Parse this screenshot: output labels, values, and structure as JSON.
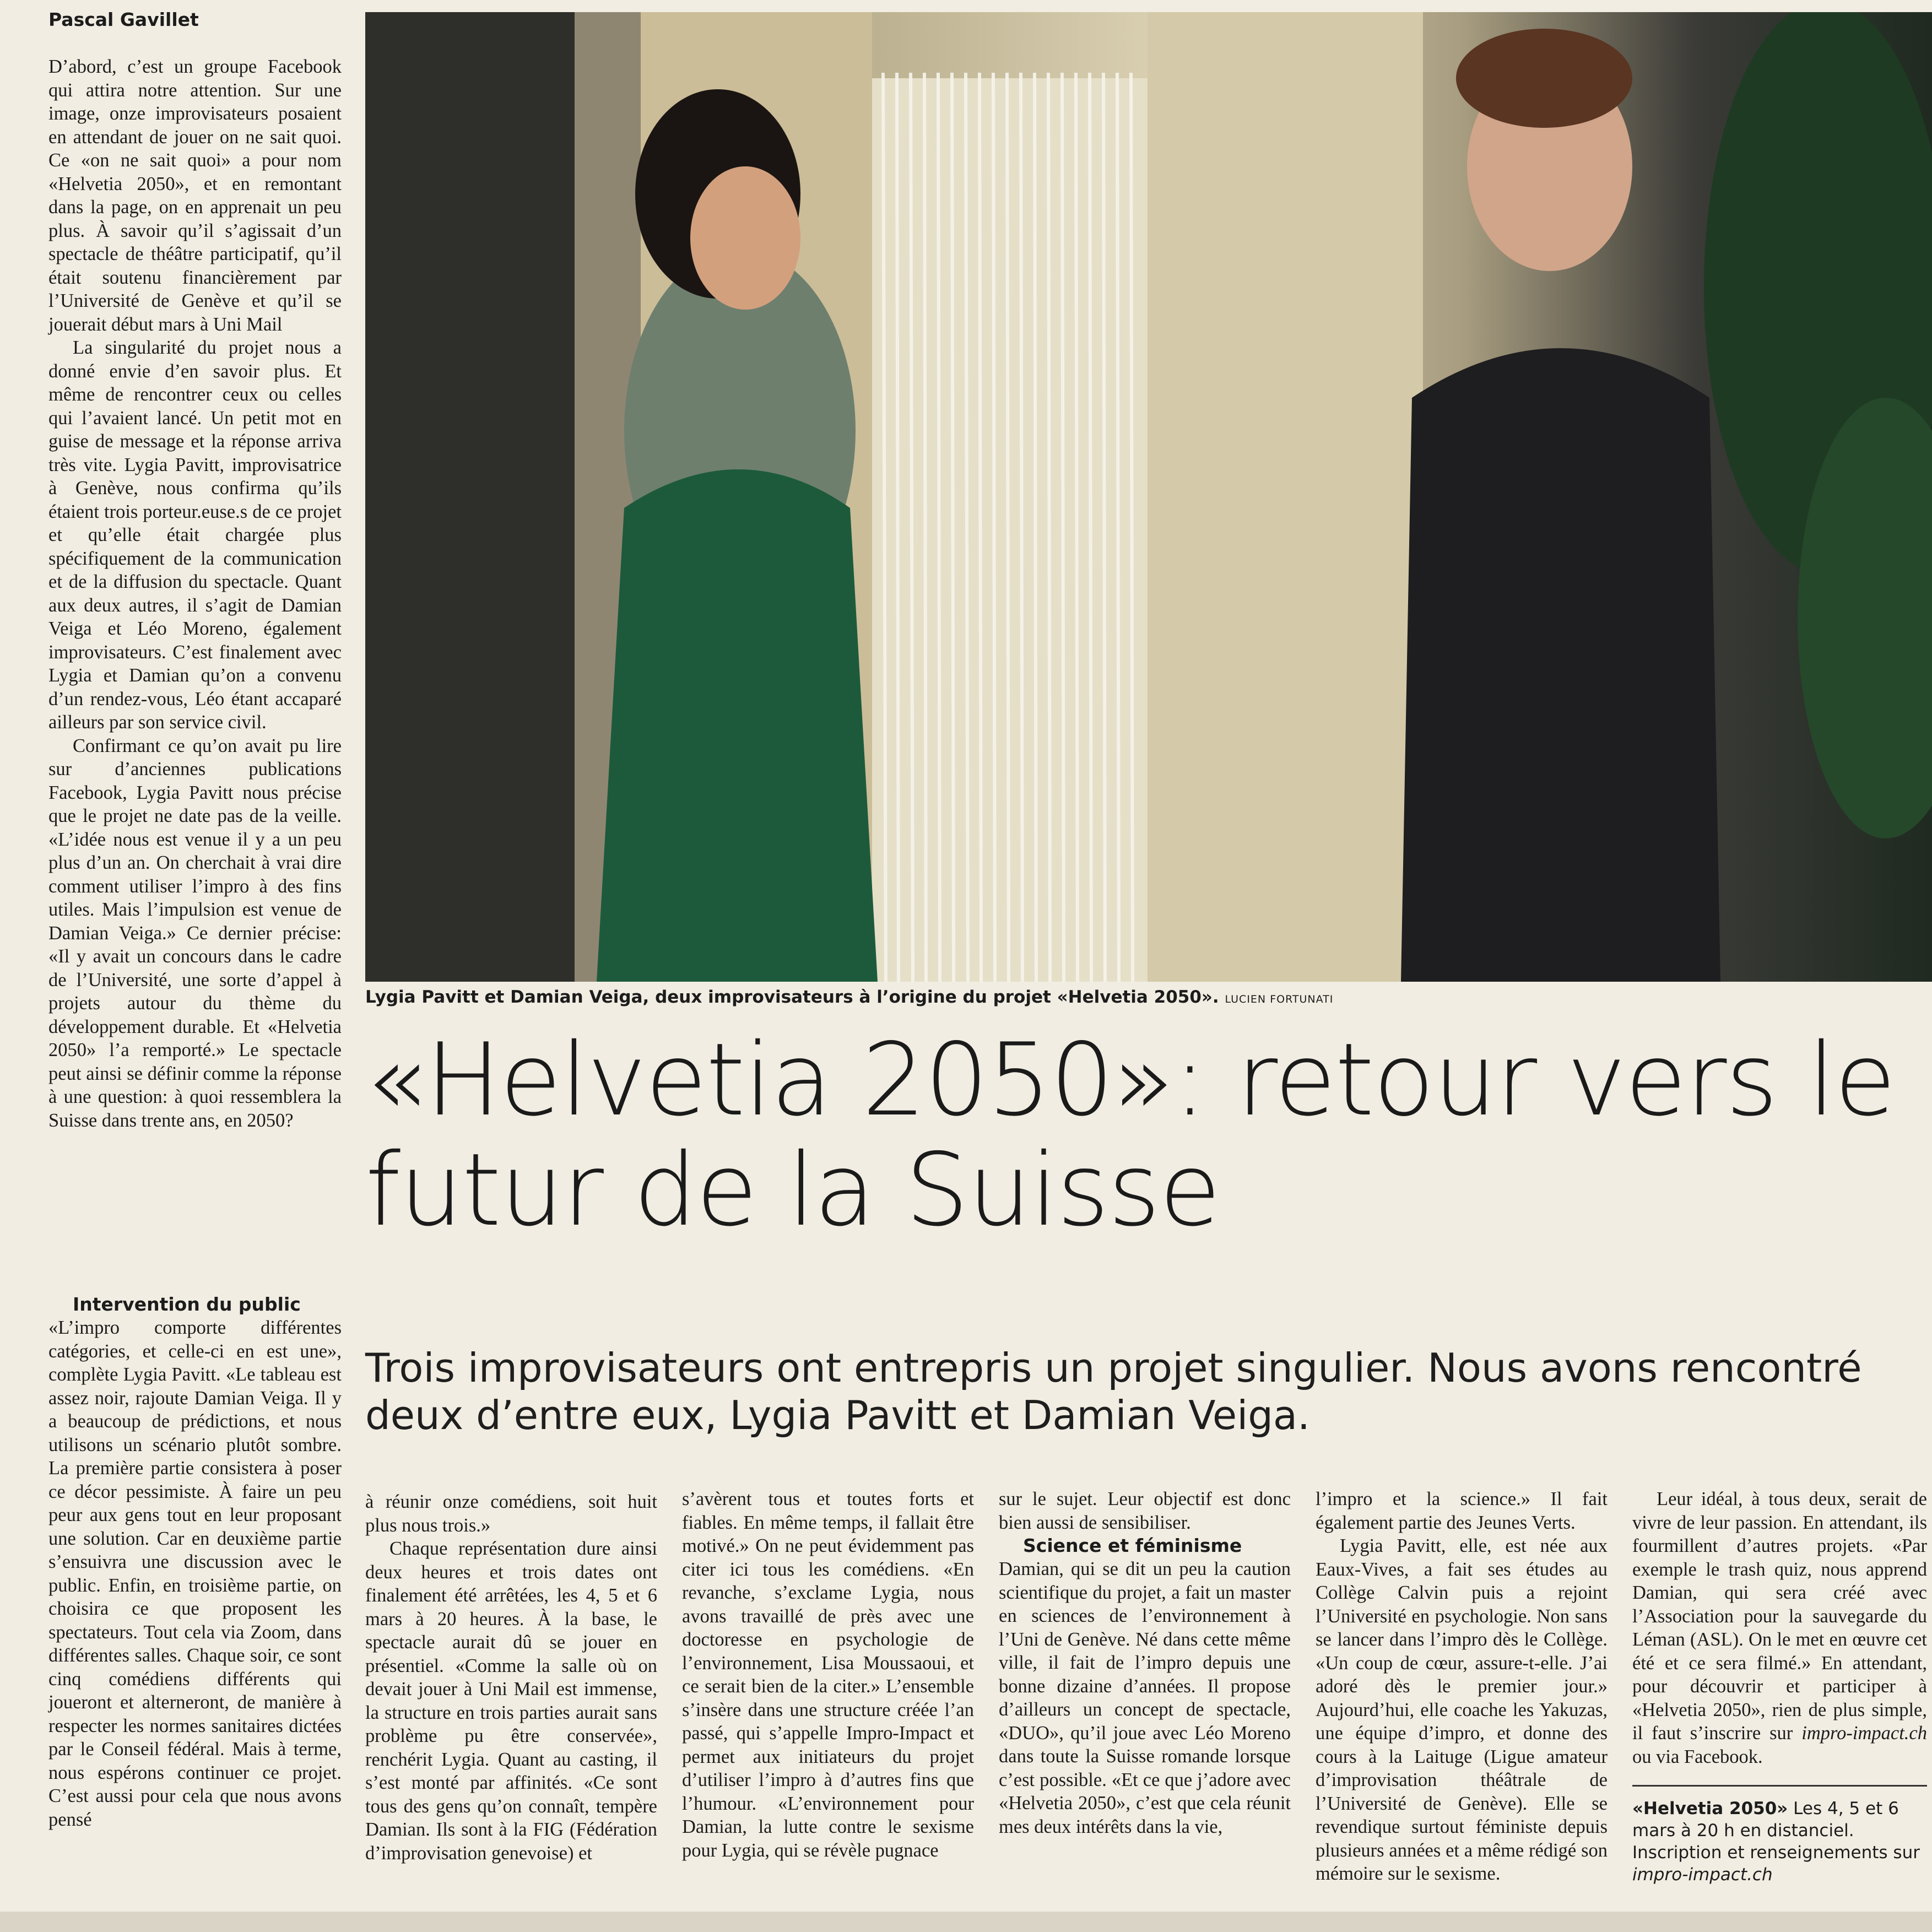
{
  "byline": "Pascal Gavillet",
  "col1_paragraphs": [
    "D’abord, c’est un groupe Facebook qui attira notre attention. Sur une image, onze improvisateurs posaient en attendant de jouer on ne sait quoi. Ce «on ne sait quoi» a pour nom «Helvetia 2050», et en remontant dans la page, on en apprenait un peu plus. À savoir qu’il s’agissait d’un spectacle de théâtre participatif, qu’il était soutenu financièrement par l’Université de Genève et qu’il se jouerait début mars à Uni Mail",
    "La singularité du projet nous a donné envie d’en savoir plus. Et même de rencontrer ceux ou celles qui l’avaient lancé. Un petit mot en guise de message et la réponse arriva très vite. Lygia Pavitt, improvisatrice à Genève, nous confirma qu’ils étaient trois porteur.euse.s de ce projet et qu’elle était chargée plus spécifiquement de la communication et de la diffusion du spectacle. Quant aux deux autres, il s’agit de Damian Veiga et Léo Moreno, également improvisateurs. C’est finalement avec Lygia et Damian qu’on a convenu d’un rendez-vous, Léo étant accaparé ailleurs par son service civil.",
    "Confirmant ce qu’on avait pu lire sur d’anciennes publications Facebook, Lygia Pavitt nous précise que le projet ne date pas de la veille. «L’idée nous est venue il y a un peu plus d’un an. On cherchait à vrai dire comment utiliser l’impro à des fins utiles. Mais l’impulsion est venue de Damian Veiga.» Ce dernier précise: «Il y avait un concours dans le cadre de l’Université, une sorte d’appel à projets autour du thème du développement durable. Et «Helvetia 2050» l’a remporté.» Le spectacle peut ainsi se définir comme la réponse à une question: à quoi ressemblera la Suisse dans trente ans, en 2050?"
  ],
  "subhead_1": "Intervention du public",
  "col1b_paragraph": "«L’impro comporte différentes catégories, et celle-ci en est une», complète Lygia Pavitt. «Le tableau est assez noir, rajoute Damian Veiga. Il y a beaucoup de prédictions, et nous utilisons un scénario plutôt sombre. La première partie consistera à poser ce décor pessimiste. À faire un peu peur aux gens tout en leur proposant une solution. Car en deuxième partie s’ensuivra une discussion avec le public. Enfin, en troisième partie, on choisira ce que proposent les spectateurs. Tout cela via Zoom, dans différentes salles. Chaque soir, ce sont cinq comédiens différents qui joueront et alterneront, de manière à respecter les normes sanitaires dictées par le Conseil fédéral. Mais à terme, nous espérons continuer ce projet. C’est aussi pour cela que nous avons pensé",
  "caption": "Lygia Pavitt et Damian Veiga, deux improvisateurs à l’origine du projet «Helvetia 2050».",
  "photo_credit": "LUCIEN FORTUNATI",
  "headline": "«Helvetia 2050»: retour vers le futur de la Suisse",
  "deck": "Trois improvisateurs ont entrepris un projet singulier. Nous avons rencontré deux d’entre eux, Lygia Pavitt et Damian Veiga.",
  "bc1_paragraphs": [
    "à réunir onze comédiens, soit huit plus nous trois.»",
    "Chaque représentation dure ainsi deux heures et trois dates ont finalement été arrêtées, les 4, 5 et 6 mars à 20 heures. À la base, le spectacle aurait dû se jouer en présentiel. «Comme la salle où on devait jouer à Uni Mail est immense, la structure en trois parties aurait sans problème pu être conservée», renchérit Lygia. Quant au casting, il s’est monté par affinités. «Ce sont tous des gens qu’on connaît, tempère Damian. Ils sont à la FIG (Fédération d’improvisation genevoise) et"
  ],
  "bc2_paragraphs": [
    "s’avèrent tous et toutes forts et fiables. En même temps, il fallait être motivé.» On ne peut évidemment pas citer ici tous les comédiens. «En revanche, s’exclame Lygia, nous avons travaillé de près avec une doctoresse en psychologie de l’environnement, Lisa Moussaoui, et ce serait bien de la citer.» L’ensemble s’insère dans une structure créée l’an passé, qui s’appelle Impro-Impact et permet aux initiateurs du projet d’utiliser l’impro à d’autres fins que l’humour. «L’environnement pour Damian, la lutte contre le sexisme pour Lygia, qui se révèle pugnace"
  ],
  "bc3_first": "sur le sujet. Leur objectif est donc bien aussi de sensibiliser.",
  "subhead_2": "Science et féminisme",
  "bc3_second": "Damian, qui se dit un peu la caution scientifique du projet, a fait un master en sciences de l’environnement à l’Uni de Genève. Né dans cette même ville, il fait de l’impro depuis une bonne dizaine d’années. Il propose d’ailleurs un concept de spectacle, «DUO», qu’il joue avec Léo Moreno dans toute la Suisse romande lorsque c’est possible. «Et ce que j’adore avec «Helvetia 2050», c’est que cela réunit mes deux intérêts dans la vie,",
  "bc4_paragraphs": [
    "l’impro et la science.» Il fait également partie des Jeunes Verts.",
    "Lygia Pavitt, elle, est née aux Eaux-Vives, a fait ses études au Collège Calvin puis a rejoint l’Université en psychologie. Non sans se lancer dans l’impro dès le Collège. «Un coup de cœur, assure-t-elle. J’ai adoré dès le premier jour.» Aujourd’hui, elle coache les Yakuzas, une équipe d’impro, et donne des cours à la Laituge (Ligue amateur d’improvisation théâtrale de l’Université de Genève). Elle se revendique surtout féministe depuis plusieurs années et a même rédigé son mémoire sur le sexisme."
  ],
  "bc5_paragraph": "Leur idéal, à tous deux, serait de vivre de leur passion. En attendant, ils fourmillent d’autres projets. «Par exemple le trash quiz, nous apprend Damian, qui sera créé avec l’Association pour la sauvegarde du Léman (ASL). On le met en œuvre cet été et ce sera filmé.» En attendant, pour découvrir et participer à «Helvetia 2050», rien de plus simple, il faut s’inscrire sur",
  "bc5_site": "impro-impact.ch",
  "bc5_tail": " ou via Facebook.",
  "info_title": "«Helvetia 2050»",
  "info_text": " Les 4, 5 et 6 mars à 20 h en distanciel. Inscription et renseignements sur ",
  "info_site": "impro-impact.ch"
}
